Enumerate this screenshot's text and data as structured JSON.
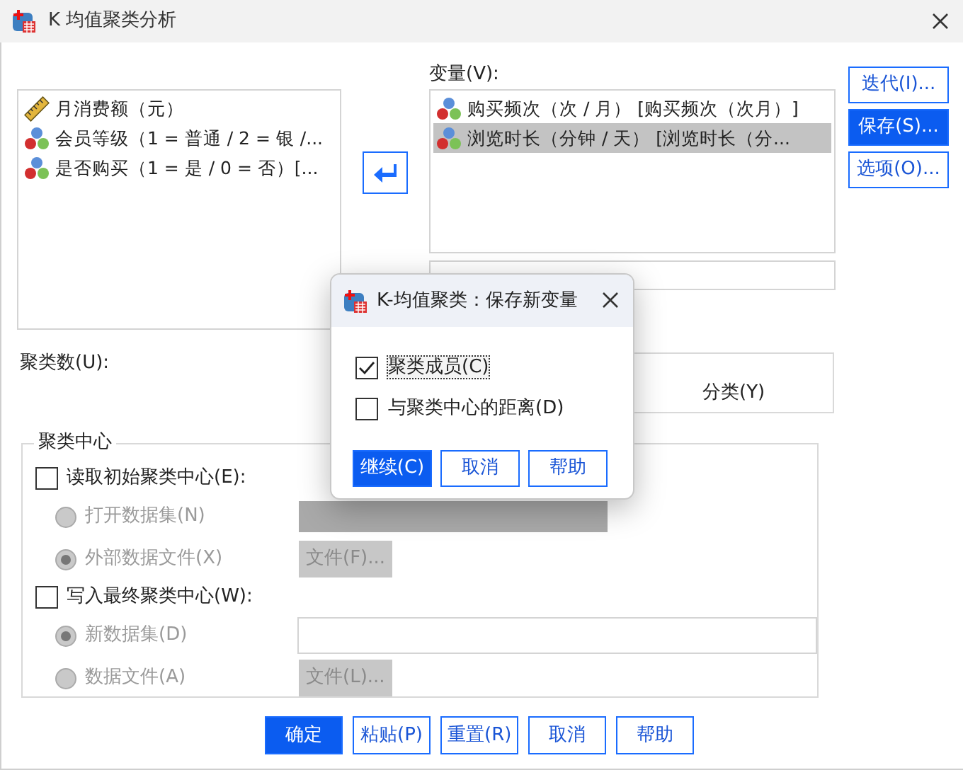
{
  "window": {
    "title": "K 均值聚类分析"
  },
  "source_list": {
    "items": [
      {
        "kind": "scale",
        "label": "月消费额（元）"
      },
      {
        "kind": "nominal",
        "label": "会员等级（1 = 普通 / 2 = 银 /..."
      },
      {
        "kind": "nominal",
        "label": "是否购买（1 = 是 / 0 = 否）[..."
      }
    ]
  },
  "variables": {
    "label": "变量(V):",
    "items": [
      {
        "kind": "nominal",
        "label": "购买频次（次 / 月） [购买频次（次月）]",
        "selected": false
      },
      {
        "kind": "nominal",
        "label": "浏览时长（分钟 / 天） [浏览时长（分...",
        "selected": true
      }
    ]
  },
  "side_buttons": [
    {
      "label": "迭代(I)...",
      "selected": false
    },
    {
      "label": "保存(S)...",
      "selected": true
    },
    {
      "label": "选项(O)...",
      "selected": false
    }
  ],
  "clusters_label": "聚类数(U):",
  "method": {
    "option_label": "分类(Y)"
  },
  "centers": {
    "legend": "聚类中心",
    "groups": [
      {
        "label": "读取初始聚类中心(E):",
        "checked": false,
        "options": [
          {
            "label": "打开数据集(N)",
            "selected": false,
            "disabled": true,
            "kind": "dropdown"
          },
          {
            "label": "外部数据文件(X)",
            "selected": true,
            "disabled": true,
            "kind": "file",
            "button": "文件(F)..."
          }
        ]
      },
      {
        "label": "写入最终聚类中心(W):",
        "checked": false,
        "options": [
          {
            "label": "新数据集(D)",
            "selected": true,
            "disabled": true,
            "kind": "input"
          },
          {
            "label": "数据文件(A)",
            "selected": false,
            "disabled": true,
            "kind": "file",
            "button": "文件(L)..."
          }
        ]
      }
    ]
  },
  "buttons": [
    {
      "label": "确定",
      "default": true
    },
    {
      "label": "粘贴(P)",
      "default": false
    },
    {
      "label": "重置(R)",
      "default": false
    },
    {
      "label": "取消",
      "default": false
    },
    {
      "label": "帮助",
      "default": false
    }
  ],
  "dialog": {
    "title": "K-均值聚类：保存新变量",
    "checkboxes": [
      {
        "label": "聚类成员(C)",
        "checked": true,
        "focused": true
      },
      {
        "label": "与聚类中心的距离(D)",
        "checked": false,
        "focused": false
      }
    ],
    "buttons": [
      {
        "label": "继续(C)",
        "default": true
      },
      {
        "label": "取消",
        "default": false
      },
      {
        "label": "帮助",
        "default": false
      }
    ]
  }
}
